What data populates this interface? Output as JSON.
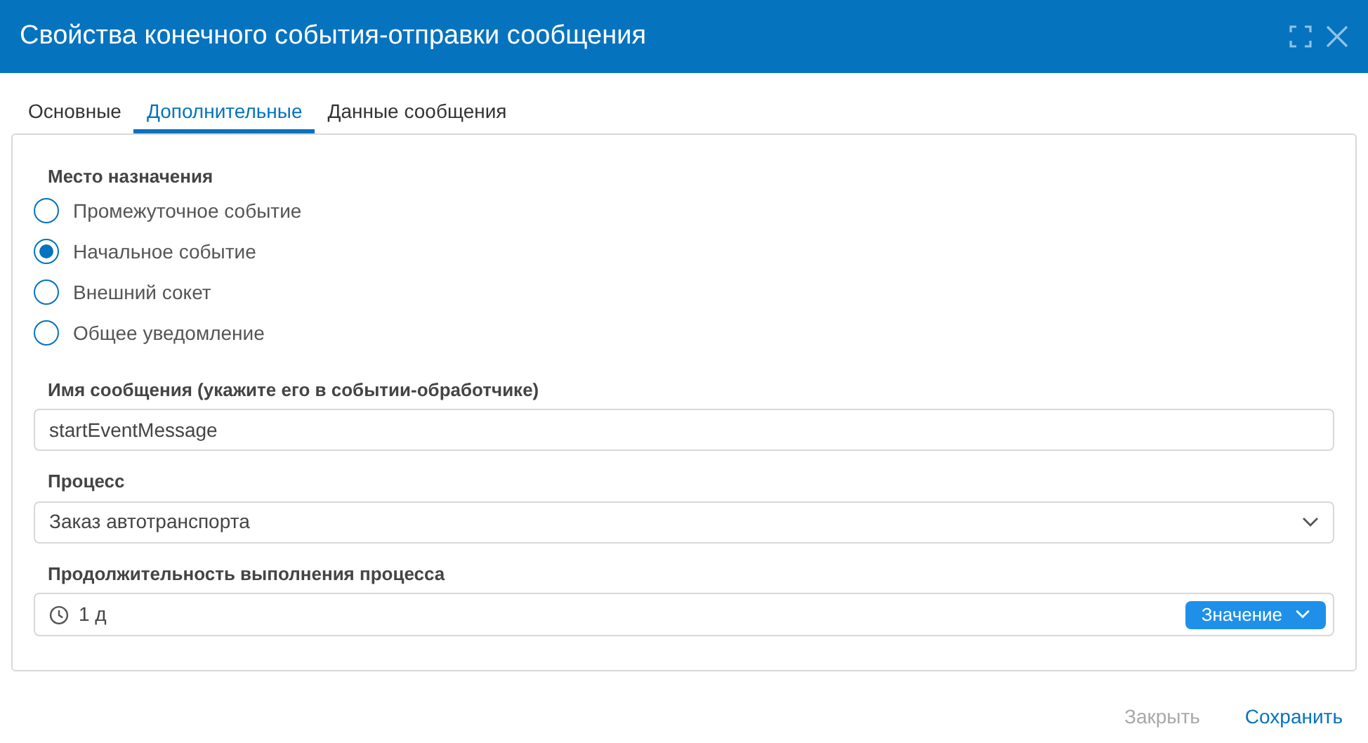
{
  "window": {
    "title": "Свойства конечного события-отправки сообщения"
  },
  "tabs": [
    {
      "label": "Основные",
      "selected": false
    },
    {
      "label": "Дополнительные",
      "selected": true
    },
    {
      "label": "Данные сообщения",
      "selected": false
    }
  ],
  "destination": {
    "label": "Место назначения",
    "options": [
      {
        "label": "Промежуточное событие",
        "selected": false
      },
      {
        "label": "Начальное событие",
        "selected": true
      },
      {
        "label": "Внешний сокет",
        "selected": false
      },
      {
        "label": "Общее уведомление",
        "selected": false
      }
    ]
  },
  "message_name": {
    "label": "Имя сообщения (укажите его в событии-обработчике)",
    "value": "startEventMessage"
  },
  "process": {
    "label": "Процесс",
    "value": "Заказ автотранспорта"
  },
  "duration": {
    "label": "Продолжительность выполнения процесса",
    "value": "1 д",
    "mode": "Значение"
  },
  "buttons": [
    {
      "label": "Закрыть",
      "disabled": true
    },
    {
      "label": "Сохранить",
      "disabled": false
    }
  ]
}
